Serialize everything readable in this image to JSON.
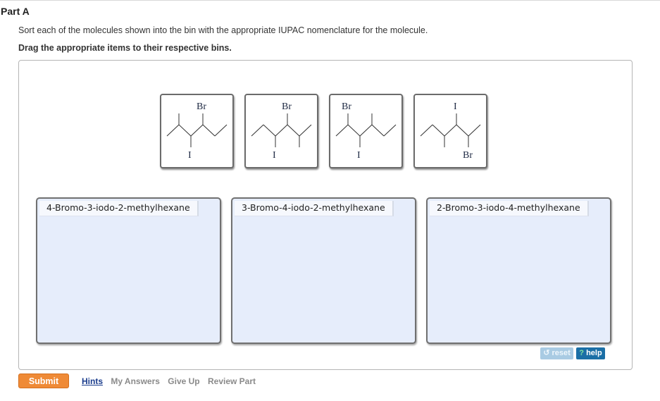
{
  "part": {
    "title": "Part A"
  },
  "instructions": "Sort each of the molecules shown into the bin with the appropriate IUPAC nomenclature for the molecule.",
  "directive": "Drag the appropriate items to their respective bins.",
  "draggables": [
    {
      "id": "molecule-1",
      "top_label": "Br",
      "bottom_label": "I",
      "structure": "4-bromo-3-iodo-2-methylhexane skeletal"
    },
    {
      "id": "molecule-2",
      "top_label": "Br",
      "bottom_label": "I",
      "structure": "3-bromo-4-iodo-2-methylhexane skeletal (mirrored)"
    },
    {
      "id": "molecule-3",
      "top_label": "Br",
      "bottom_label": "I",
      "structure": "2-bromo-3-iodo-4-methylhexane skeletal"
    },
    {
      "id": "molecule-4",
      "top_label": "I",
      "bottom_label": "Br",
      "structure": "2-bromo-3-iodo-4-methylhexane skeletal (mirrored)"
    }
  ],
  "bins": [
    {
      "label": "4-Bromo-3-iodo-2-methylhexane"
    },
    {
      "label": "3-Bromo-4-iodo-2-methylhexane"
    },
    {
      "label": "2-Bromo-3-iodo-4-methylhexane"
    }
  ],
  "controls": {
    "reset": {
      "icon": "undo-icon",
      "label": "reset"
    },
    "help": {
      "icon": "question-icon",
      "q": "?",
      "label": "help"
    }
  },
  "footer": {
    "submit": "Submit",
    "links": [
      "Hints",
      "My Answers",
      "Give Up",
      "Review Part"
    ]
  },
  "colors": {
    "submit": "#ef8a36",
    "bin_background": "#e6edfb",
    "help": "#1b6fa6",
    "reset": "#a9cbe3",
    "hints_link": "#1a3c8c"
  }
}
